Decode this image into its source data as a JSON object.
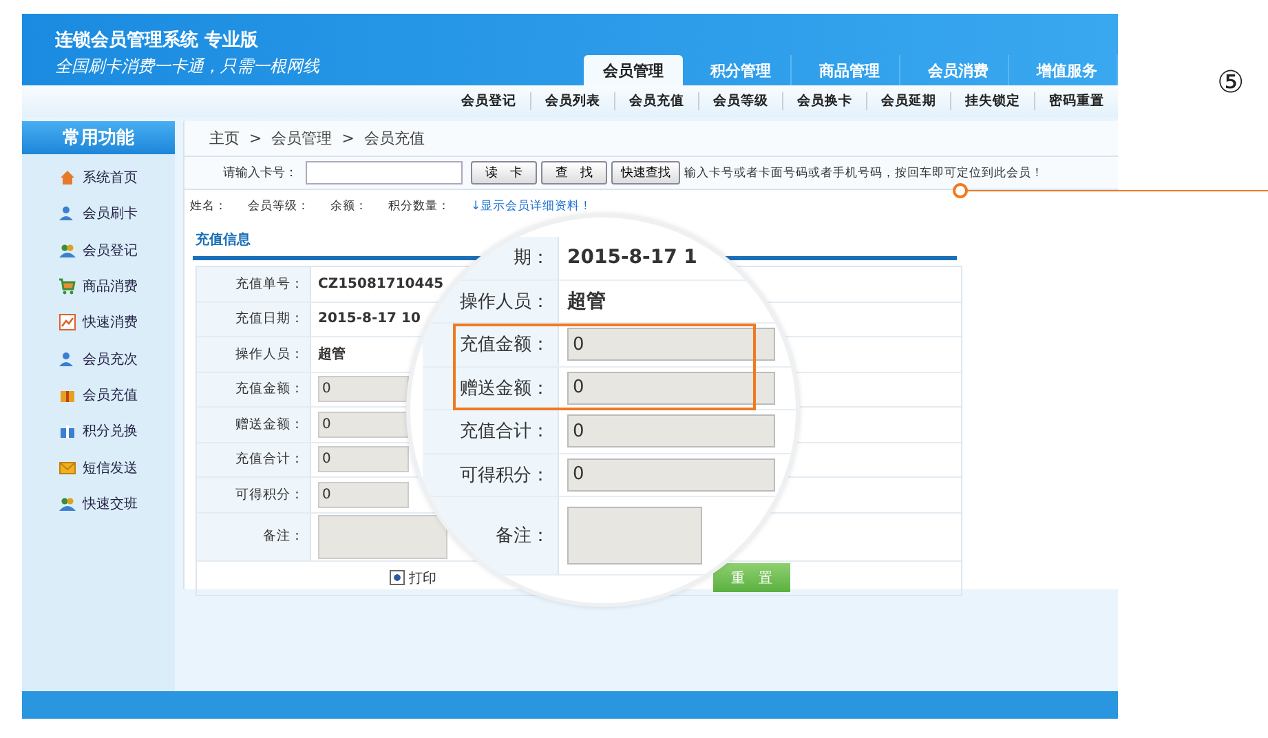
{
  "header": {
    "title": "连锁会员管理系统 专业版",
    "slogan": "全国刷卡消费一卡通，只需一根网线"
  },
  "main_tabs": [
    {
      "label": "会员管理",
      "selected": true
    },
    {
      "label": "积分管理",
      "selected": false
    },
    {
      "label": "商品管理",
      "selected": false
    },
    {
      "label": "会员消费",
      "selected": false
    },
    {
      "label": "增值服务",
      "selected": false
    }
  ],
  "sub_menu": [
    "会员登记",
    "会员列表",
    "会员充值",
    "会员等级",
    "会员换卡",
    "会员延期",
    "挂失锁定",
    "密码重置"
  ],
  "sidebar": {
    "title": "常用功能",
    "items": [
      "系统首页",
      "会员刷卡",
      "会员登记",
      "商品消费",
      "快速消费",
      "会员充次",
      "会员充值",
      "积分兑换",
      "短信发送",
      "快速交班"
    ]
  },
  "breadcrumb": [
    "主页",
    ">",
    "会员管理",
    ">",
    "会员充值"
  ],
  "card_search": {
    "label": "请输入卡号：",
    "buttons": [
      "读　卡",
      "查　找",
      "快速查找"
    ],
    "hint": "输入卡号或者卡面号码或者手机号码，按回车即可定位到此会员！"
  },
  "member_info": {
    "fields": [
      "姓名：",
      "会员等级：",
      "余额：",
      "积分数量："
    ],
    "link": "↓显示会员详细资料！"
  },
  "section_title": "充值信息",
  "form_rows": [
    {
      "label": "充值单号：",
      "kind": "text",
      "value": "CZ15081710445"
    },
    {
      "label": "充值日期：",
      "kind": "text",
      "value": "2015-8-17 10"
    },
    {
      "label": "操作人员：",
      "kind": "text",
      "value": "超管"
    },
    {
      "label": "充值金额：",
      "kind": "input",
      "value": "0"
    },
    {
      "label": "赠送金额：",
      "kind": "input",
      "value": "0"
    },
    {
      "label": "充值合计：",
      "kind": "input",
      "value": "0"
    },
    {
      "label": "可得积分：",
      "kind": "input",
      "value": "0"
    },
    {
      "label": "备注：",
      "kind": "textarea"
    }
  ],
  "print_receipt": {
    "label": "打印",
    "checked": true
  },
  "reset_button": "重　置",
  "magnifier": {
    "rows": [
      {
        "label": "期：",
        "kind": "text",
        "value": "2015-8-17 1",
        "highlighted": false
      },
      {
        "label": "操作人员：",
        "kind": "text",
        "value": "超管",
        "highlighted": false
      },
      {
        "label": "充值金额：",
        "kind": "input",
        "value": "0",
        "highlighted": true
      },
      {
        "label": "赠送金额：",
        "kind": "input",
        "value": "0",
        "highlighted": true
      },
      {
        "label": "充值合计：",
        "kind": "input",
        "value": "0",
        "highlighted": false
      },
      {
        "label": "可得积分：",
        "kind": "input",
        "value": "0",
        "highlighted": false
      },
      {
        "label": "备注：",
        "kind": "textarea",
        "highlighted": false
      }
    ]
  },
  "step_marker": "⑤"
}
